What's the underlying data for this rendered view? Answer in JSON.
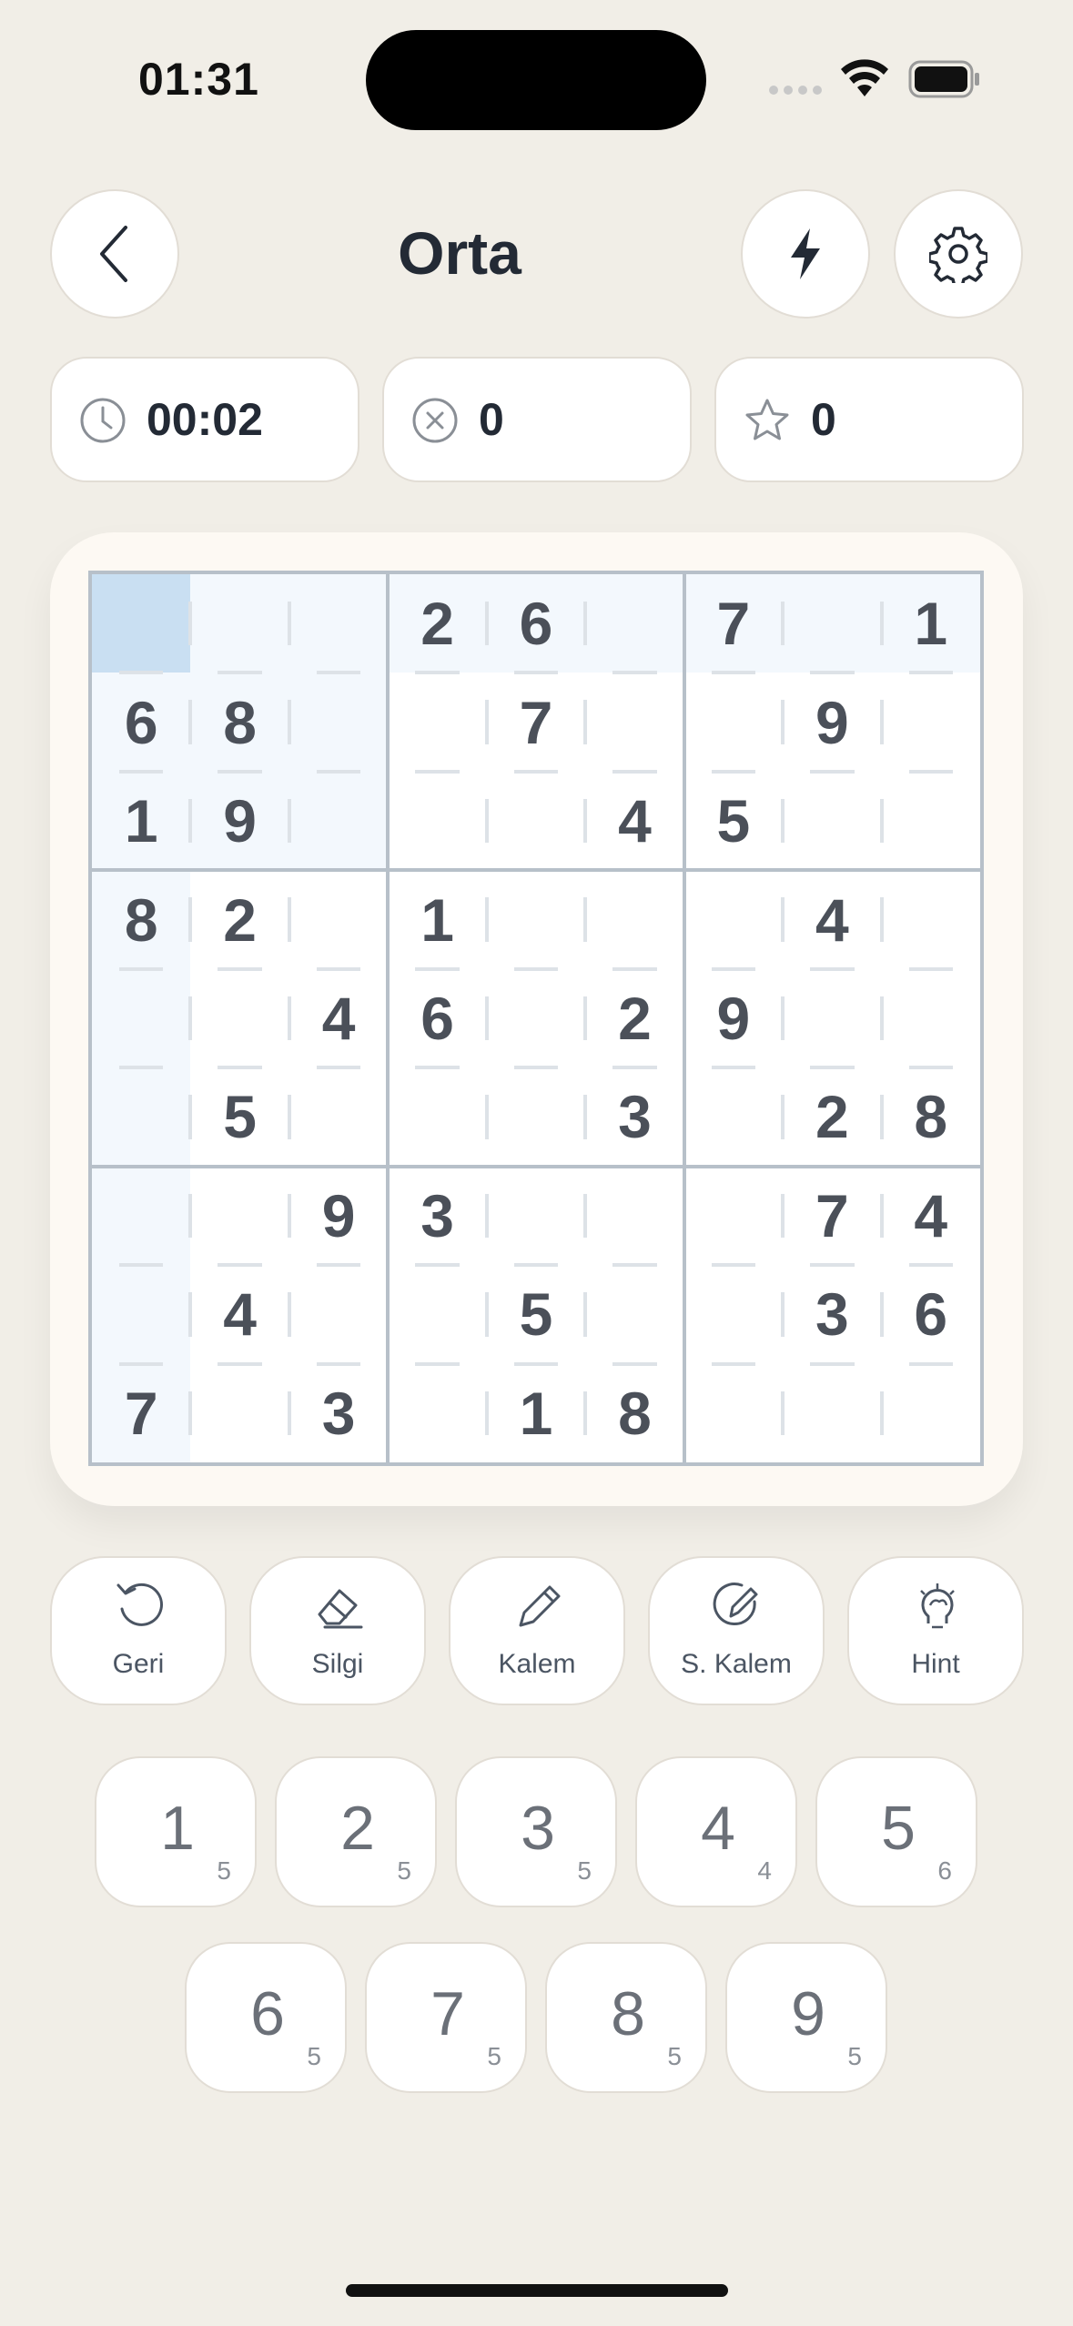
{
  "status": {
    "time": "01:31"
  },
  "header": {
    "title": "Orta"
  },
  "stats": {
    "time": "00:02",
    "mistakes": "0",
    "score": "0"
  },
  "board": {
    "grid": [
      [
        "",
        "",
        "",
        "2",
        "6",
        "",
        "7",
        "",
        "1"
      ],
      [
        "6",
        "8",
        "",
        "",
        "7",
        "",
        "",
        "9",
        ""
      ],
      [
        "1",
        "9",
        "",
        "",
        "",
        "4",
        "5",
        "",
        ""
      ],
      [
        "8",
        "2",
        "",
        "1",
        "",
        "",
        "",
        "4",
        ""
      ],
      [
        "",
        "",
        "4",
        "6",
        "",
        "2",
        "9",
        "",
        ""
      ],
      [
        "",
        "5",
        "",
        "",
        "",
        "3",
        "",
        "2",
        "8"
      ],
      [
        "",
        "",
        "9",
        "3",
        "",
        "",
        "",
        "7",
        "4"
      ],
      [
        "",
        "4",
        "",
        "",
        "5",
        "",
        "",
        "3",
        "6"
      ],
      [
        "7",
        "",
        "3",
        "",
        "1",
        "8",
        "",
        "",
        ""
      ]
    ],
    "selected": [
      0,
      0
    ]
  },
  "tools": [
    {
      "label": "Geri",
      "icon": "undo-icon"
    },
    {
      "label": "Silgi",
      "icon": "eraser-icon"
    },
    {
      "label": "Kalem",
      "icon": "pencil-icon"
    },
    {
      "label": "S. Kalem",
      "icon": "smart-pencil-icon"
    },
    {
      "label": "Hint",
      "icon": "brain-bulb-icon"
    }
  ],
  "numpad": [
    {
      "digit": "1",
      "count": "5"
    },
    {
      "digit": "2",
      "count": "5"
    },
    {
      "digit": "3",
      "count": "5"
    },
    {
      "digit": "4",
      "count": "4"
    },
    {
      "digit": "5",
      "count": "6"
    },
    {
      "digit": "6",
      "count": "5"
    },
    {
      "digit": "7",
      "count": "5"
    },
    {
      "digit": "8",
      "count": "5"
    },
    {
      "digit": "9",
      "count": "5"
    }
  ],
  "colors": {
    "background": "#f1eee7",
    "highlight": "#f3f8fd",
    "selected": "#c9dff2",
    "digit": "#4b5059"
  }
}
